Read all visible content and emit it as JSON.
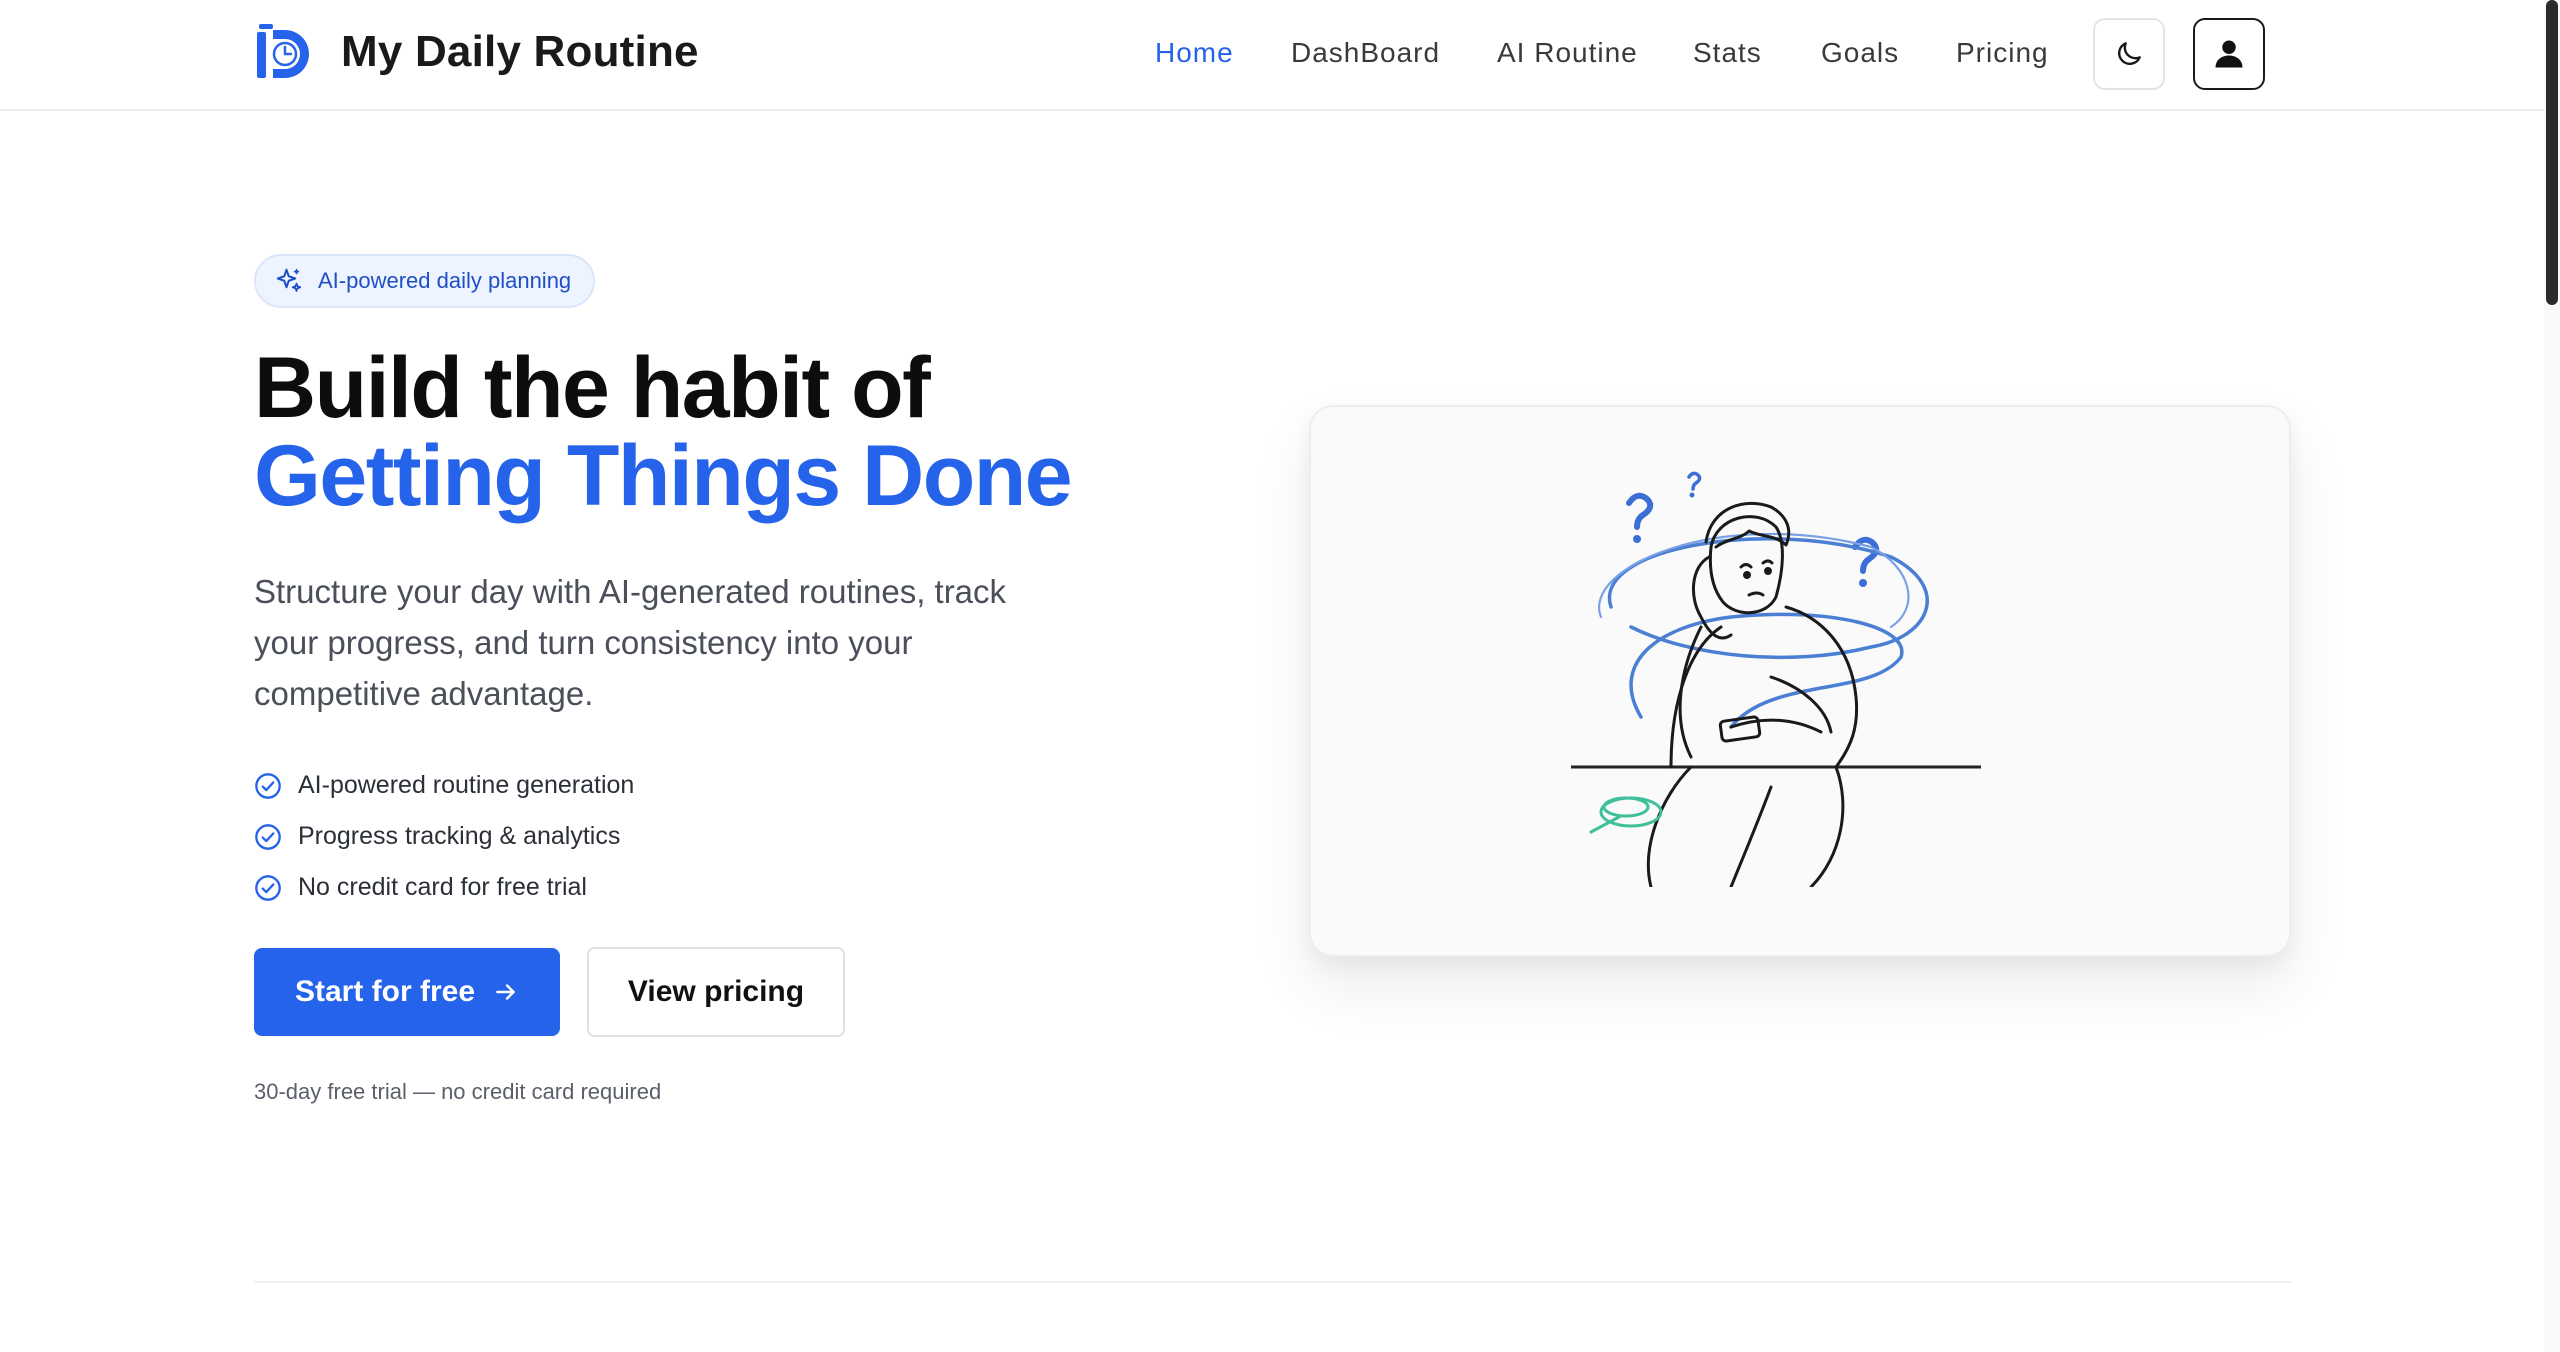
{
  "brand": {
    "name": "My Daily Routine",
    "logo_icon": "clock-d-logo-icon"
  },
  "nav": {
    "items": [
      {
        "label": "Home",
        "active": true
      },
      {
        "label": "DashBoard",
        "active": false
      },
      {
        "label": "AI Routine",
        "active": false
      },
      {
        "label": "Stats",
        "active": false
      },
      {
        "label": "Goals",
        "active": false
      },
      {
        "label": "Pricing",
        "active": false
      }
    ],
    "theme_toggle_icon": "moon-icon",
    "account_icon": "user-icon"
  },
  "hero": {
    "badge": {
      "icon": "sparkles-icon",
      "text": "AI-powered daily planning"
    },
    "headline_line1": "Build the habit of",
    "headline_line2": "Getting Things Done",
    "lead": "Structure your day with AI-generated routines, track your progress, and turn consistency into your competitive advantage.",
    "features": [
      {
        "icon": "check-circle-icon",
        "text": "AI-powered routine generation"
      },
      {
        "icon": "check-circle-icon",
        "text": "Progress tracking & analytics"
      },
      {
        "icon": "check-circle-icon",
        "text": "No credit card for free trial"
      }
    ],
    "primary_cta": {
      "label": "Start for free",
      "icon": "arrow-right-icon"
    },
    "secondary_cta": {
      "label": "View pricing"
    },
    "note": "30-day free trial — no credit card required"
  },
  "illustration": {
    "icon": "confused-person-illustration"
  },
  "colors": {
    "accent": "#2563eb",
    "heading": "#0d0d0d",
    "body_text": "#4a4f5a",
    "badge_bg": "#eef4ff"
  }
}
